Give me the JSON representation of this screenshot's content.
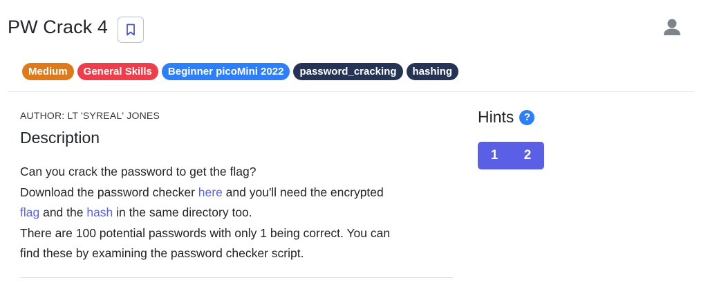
{
  "header": {
    "title": "PW Crack 4",
    "bookmark_icon": "bookmark-icon",
    "user_icon": "user-icon"
  },
  "tags": [
    {
      "label": "Medium",
      "color": "#dd7a1c"
    },
    {
      "label": "General Skills",
      "color": "#ee3e4b"
    },
    {
      "label": "Beginner picoMini 2022",
      "color": "#2d7ff9"
    },
    {
      "label": "password_cracking",
      "color": "#253455"
    },
    {
      "label": "hashing",
      "color": "#253455"
    }
  ],
  "main": {
    "author": "AUTHOR: LT 'SYREAL' JONES",
    "heading": "Description",
    "line1": "Can you crack the password to get the flag?",
    "line2_pre": "Download the password checker ",
    "link_here": "here",
    "line2_post": " and you'll need the encrypted",
    "link_flag": "flag",
    "line3_mid": " and the ",
    "link_hash": "hash",
    "line3_post": " in the same directory too.",
    "line4": "There are 100 potential passwords with only 1 being correct. You can",
    "line5": "find these by examining the password checker script."
  },
  "hints": {
    "title": "Hints",
    "help_glyph": "?",
    "buttons": [
      "1",
      "2"
    ]
  },
  "colors": {
    "link": "#5b63e6",
    "hint_button": "#5a5fe6",
    "help": "#2d7ff9"
  }
}
